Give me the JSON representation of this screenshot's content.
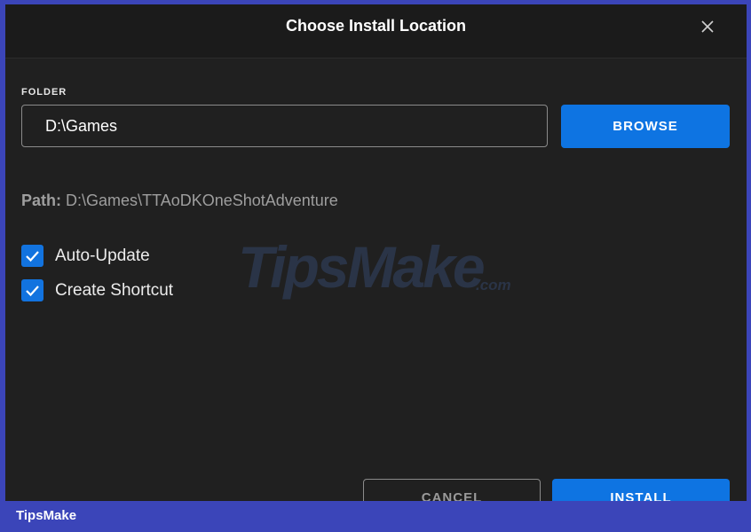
{
  "dialog": {
    "title": "Choose Install Location",
    "folder_label": "FOLDER",
    "folder_value": "D:\\Games",
    "browse_label": "BROWSE",
    "path_label": "Path:",
    "path_value": "D:\\Games\\TTAoDKOneShotAdventure",
    "options": [
      {
        "label": "Auto-Update",
        "checked": true
      },
      {
        "label": "Create Shortcut",
        "checked": true
      }
    ],
    "cancel_label": "CANCEL",
    "install_label": "INSTALL"
  },
  "watermark": {
    "main": "TipsMake",
    "suffix": ".com"
  },
  "footer": {
    "brand": "TipsMake"
  },
  "colors": {
    "accent": "#0e74e2",
    "dialog_bg": "#202020",
    "frame_bg": "#3b45b9"
  },
  "icons": {
    "close": "close-icon",
    "check": "check-icon"
  }
}
